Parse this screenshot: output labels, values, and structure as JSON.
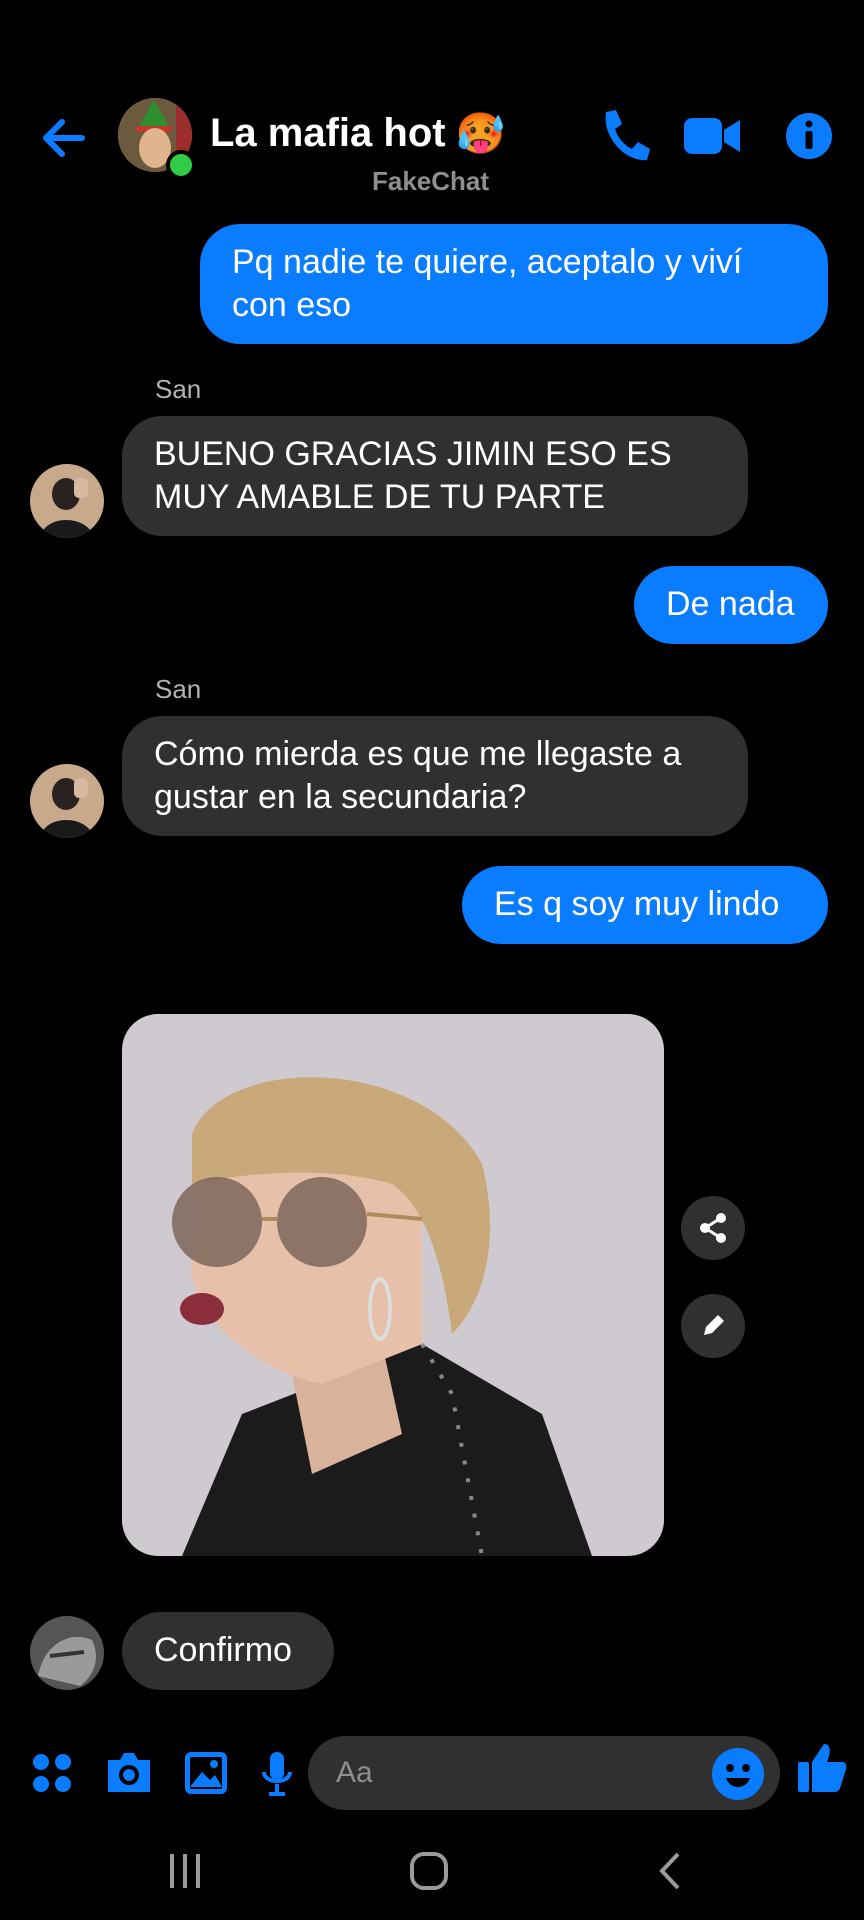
{
  "header": {
    "title": "La mafia hot",
    "title_emoji": "🥵",
    "subtitle": "FakeChat"
  },
  "messages": [
    {
      "id": "m1",
      "dir": "out",
      "text": "Pq nadie te quiere, aceptalo y viví con eso"
    },
    {
      "id": "m2",
      "dir": "in",
      "sender": "San",
      "text": "BUENO GRACIAS JIMIN ESO ES MUY AMABLE DE TU PARTE"
    },
    {
      "id": "m3",
      "dir": "out",
      "text": "De nada"
    },
    {
      "id": "m4",
      "dir": "in",
      "sender": "San",
      "text": "Cómo mierda es que me llegaste a gustar en la secundaria?"
    },
    {
      "id": "m5",
      "dir": "out",
      "text": "Es q soy muy lindo"
    },
    {
      "id": "m6",
      "dir": "in",
      "type": "photo"
    },
    {
      "id": "m7",
      "dir": "in",
      "text": "Confirmo"
    }
  ],
  "composer": {
    "placeholder": "Aa"
  },
  "icons": {
    "back": "arrow-left-icon",
    "phone": "phone-icon",
    "video": "video-camera-icon",
    "info": "info-icon",
    "menu": "four-dots-icon",
    "camera": "camera-icon",
    "gallery": "image-icon",
    "mic": "microphone-icon",
    "emoji": "emoji-icon",
    "like": "thumbs-up-icon",
    "share": "share-icon",
    "edit": "pencil-icon"
  },
  "colors": {
    "accent": "#0a7cff",
    "background": "#000000",
    "incoming_bubble": "#303030",
    "online": "#31cc46"
  }
}
